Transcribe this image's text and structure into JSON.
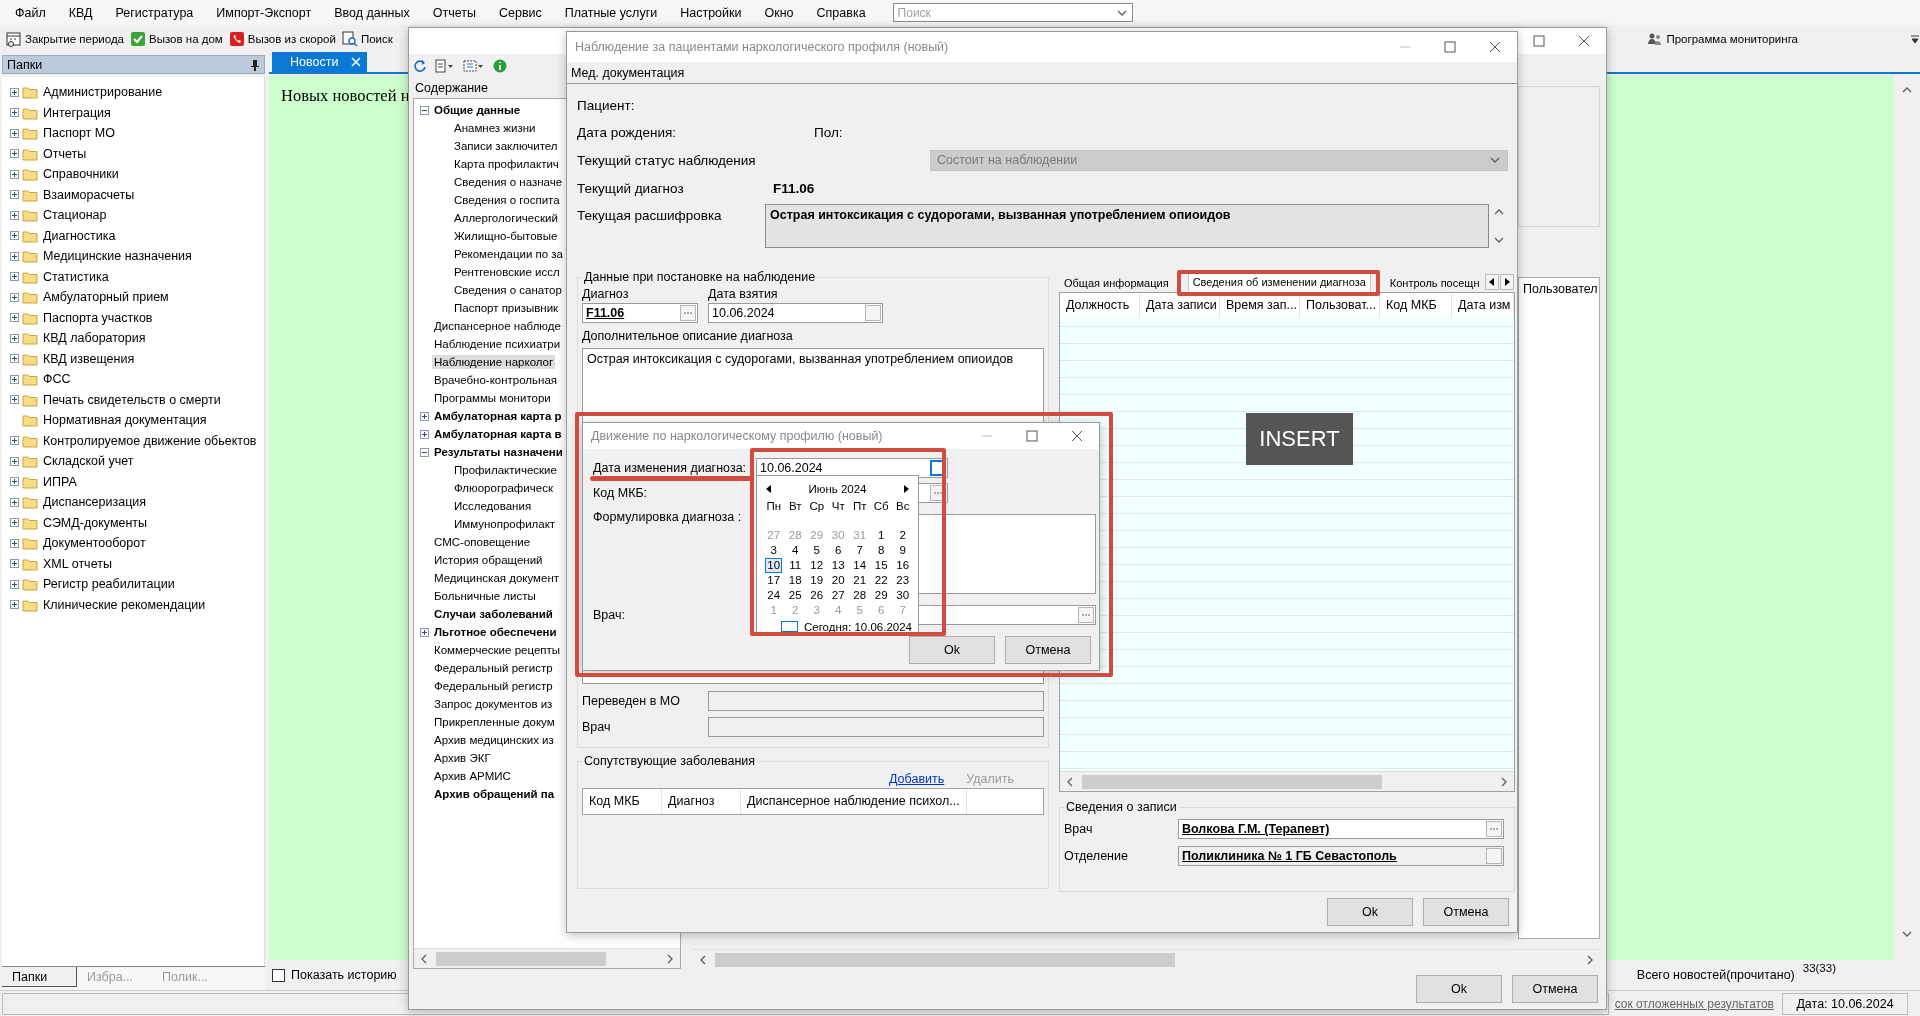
{
  "menu": [
    "Файл",
    "КВД",
    "Регистратура",
    "Импорт-Экспорт",
    "Ввод данных",
    "Отчеты",
    "Сервис",
    "Платные услуги",
    "Настройки",
    "Окно",
    "Справка"
  ],
  "search": {
    "placeholder": "Поиск"
  },
  "toolbar": [
    {
      "label": "Закрытие периода",
      "kind": "period"
    },
    {
      "label": "Вызов на дом",
      "kind": "home"
    },
    {
      "label": "Вызов из скорой",
      "kind": "ambulance"
    },
    {
      "label": "Поиск",
      "kind": "search"
    }
  ],
  "toolbar_right": {
    "label": "Программа мониторинга"
  },
  "folders": {
    "title": "Папки",
    "items": [
      {
        "label": "Администрирование",
        "kind": "group"
      },
      {
        "label": "Интеграция",
        "kind": "group"
      },
      {
        "label": "Паспорт МО",
        "kind": "group"
      },
      {
        "label": "Отчеты",
        "kind": "group"
      },
      {
        "label": "Справочники",
        "kind": "group"
      },
      {
        "label": "Взаиморасчеты",
        "kind": "group"
      },
      {
        "label": "Стационар",
        "kind": "group"
      },
      {
        "label": "Диагностика",
        "kind": "group"
      },
      {
        "label": "Медицинские назначения",
        "kind": "group"
      },
      {
        "label": "Статистика",
        "kind": "group"
      },
      {
        "label": "Амбулаторный прием",
        "kind": "group"
      },
      {
        "label": "Паспорта участков",
        "kind": "group"
      },
      {
        "label": "КВД лаборатория",
        "kind": "group"
      },
      {
        "label": "КВД извещения",
        "kind": "group"
      },
      {
        "label": "ФСС",
        "kind": "group"
      },
      {
        "label": "Печать свидетельств о смерти",
        "kind": "group"
      },
      {
        "label": "Нормативная документация",
        "kind": "leaf"
      },
      {
        "label": "Контролируемое движение обьектов",
        "kind": "group"
      },
      {
        "label": "Складской учет",
        "kind": "group"
      },
      {
        "label": "ИПРА",
        "kind": "group"
      },
      {
        "label": "Диспансеризация",
        "kind": "group"
      },
      {
        "label": "СЭМД-документы",
        "kind": "group"
      },
      {
        "label": "Документооборот",
        "kind": "group"
      },
      {
        "label": "XML отчеты",
        "kind": "group"
      },
      {
        "label": "Регистр реабилитации",
        "kind": "group"
      },
      {
        "label": "Клинические рекомендации",
        "kind": "group"
      }
    ],
    "tabs": [
      {
        "label": "Папки",
        "selected": true
      },
      {
        "label": "Избра...",
        "selected": false
      },
      {
        "label": "Полик...",
        "selected": false
      }
    ]
  },
  "news": {
    "tab": "Новости",
    "message": "Новых новостей н",
    "show_history": {
      "label": "Показать историю",
      "checked": false
    },
    "total_label": "Всего новостей(прочитано)",
    "total_count": "33(33)"
  },
  "status_bar": {
    "link": "сок отложенных результатов",
    "date": "Дата: 10.06.2024"
  },
  "contents_window": {
    "label": "Содержание",
    "column": "Пользовател",
    "buttons": [
      "Ok",
      "Отмена"
    ],
    "tree": [
      {
        "label": "Общие данные",
        "kind": "group",
        "expanded": true,
        "bold": true,
        "selected": false,
        "children": [
          {
            "label": "Анамнез жизни",
            "kind": "leaf",
            "bold": false,
            "selected": false
          },
          {
            "label": "Записи заключител",
            "kind": "leaf",
            "bold": false,
            "selected": false
          },
          {
            "label": "Карта профилактич",
            "kind": "leaf",
            "bold": false,
            "selected": false
          },
          {
            "label": "Сведения о назначе",
            "kind": "leaf",
            "bold": false,
            "selected": false
          },
          {
            "label": "Сведения о госпита",
            "kind": "leaf",
            "bold": false,
            "selected": false
          },
          {
            "label": "Аллергологический",
            "kind": "leaf",
            "bold": false,
            "selected": false
          },
          {
            "label": "Жилищно-бытовые",
            "kind": "leaf",
            "bold": false,
            "selected": false
          },
          {
            "label": "Рекомендации по за",
            "kind": "leaf",
            "bold": false,
            "selected": false
          },
          {
            "label": "Рентгеновские иссл",
            "kind": "leaf",
            "bold": false,
            "selected": false
          },
          {
            "label": "Сведения о санатор",
            "kind": "leaf",
            "bold": false,
            "selected": false
          },
          {
            "label": "Паспорт призывник",
            "kind": "leaf",
            "bold": false,
            "selected": false
          }
        ]
      },
      {
        "label": "Диспансерное наблюде",
        "kind": "leaf",
        "bold": false,
        "selected": false
      },
      {
        "label": "Наблюдение психиатри",
        "kind": "leaf",
        "bold": false,
        "selected": false
      },
      {
        "label": "Наблюдение нарколог",
        "kind": "leaf",
        "bold": false,
        "selected": true
      },
      {
        "label": "Врачебно-контрольная",
        "kind": "leaf",
        "bold": false,
        "selected": false
      },
      {
        "label": "Программы монитори",
        "kind": "leaf",
        "bold": false,
        "selected": false
      },
      {
        "label": "Амбулаторная карта р",
        "kind": "group",
        "expanded": false,
        "bold": true,
        "selected": false
      },
      {
        "label": "Амбулаторная карта в",
        "kind": "group",
        "expanded": false,
        "bold": true,
        "selected": false
      },
      {
        "label": "Результаты назначени",
        "kind": "group",
        "expanded": true,
        "bold": true,
        "selected": false,
        "children": [
          {
            "label": "Профилактические",
            "kind": "leaf",
            "bold": false,
            "selected": false
          },
          {
            "label": "Флюорографическ",
            "kind": "leaf",
            "bold": false,
            "selected": false
          },
          {
            "label": "Исследования",
            "kind": "leaf",
            "bold": false,
            "selected": false
          },
          {
            "label": "Иммунопрофилакт",
            "kind": "leaf",
            "bold": false,
            "selected": false
          }
        ]
      },
      {
        "label": "СМС-оповещение",
        "kind": "leaf",
        "bold": false,
        "selected": false
      },
      {
        "label": "История обращений",
        "kind": "leaf",
        "bold": false,
        "selected": false
      },
      {
        "label": "Медицинская документ",
        "kind": "leaf",
        "bold": false,
        "selected": false
      },
      {
        "label": "Больничные листы",
        "kind": "leaf",
        "bold": false,
        "selected": false
      },
      {
        "label": "Случаи заболеваний",
        "kind": "leaf",
        "bold": true,
        "selected": false
      },
      {
        "label": "Льготное обеспечени",
        "kind": "group",
        "expanded": false,
        "bold": true,
        "selected": false
      },
      {
        "label": "Коммерческие рецепты",
        "kind": "leaf",
        "bold": false,
        "selected": false
      },
      {
        "label": "Федеральный регистр",
        "kind": "leaf",
        "bold": false,
        "selected": false
      },
      {
        "label": "Федеральный регистр",
        "kind": "leaf",
        "bold": false,
        "selected": false
      },
      {
        "label": "Запрос документов из",
        "kind": "leaf",
        "bold": false,
        "selected": false
      },
      {
        "label": "Прикрепленные докум",
        "kind": "leaf",
        "bold": false,
        "selected": false
      },
      {
        "label": "Архив медицинских из",
        "kind": "leaf",
        "bold": false,
        "selected": false
      },
      {
        "label": "Архив ЭКГ",
        "kind": "leaf",
        "bold": false,
        "selected": false
      },
      {
        "label": "Архив АРМИС",
        "kind": "leaf",
        "bold": false,
        "selected": false
      },
      {
        "label": "Архив обращений па",
        "kind": "leaf",
        "bold": true,
        "selected": false
      }
    ]
  },
  "observation_dialog": {
    "title": "Наблюдение за пациентами наркологического профиля (новый)",
    "menu": "Мед. документация",
    "patient_label": "Пациент:",
    "birth_label": "Дата рождения:",
    "sex_label": "Пол:",
    "status_label": "Текущий статус наблюдения",
    "status_value": "Состоит на наблюдении",
    "diagnosis_label": "Текущий диагноз",
    "diagnosis_value": "F11.06",
    "decoding_label": "Текущая расшифровка",
    "decoding_value": "Острая интоксикация с судорогами, вызванная употреблением опиоидов",
    "registration": {
      "title": "Данные при постановке на наблюдение",
      "diagnosis_label": "Диагноз",
      "diagnosis_value": "F11.06",
      "date_label": "Дата взятия",
      "date_value": "10.06.2024",
      "extra_label": "Дополнительное описание диагноза",
      "extra_value": "Острая интоксикация с судорогами, вызванная употреблением опиоидов",
      "transferred_label": "Переведен в МО",
      "doctor_label": "Врач"
    },
    "comorbid": {
      "title": "Сопутствующие заболевания",
      "add": "Добавить",
      "delete": "Удалить",
      "columns": [
        "Код МКБ",
        "Диагноз",
        "Диспансерное наблюдение психол..."
      ]
    },
    "tabs": [
      {
        "label": "Общая информация",
        "selected": false
      },
      {
        "label": "Сведения об изменении диагноза",
        "selected": true
      },
      {
        "label": "Контроль посещн",
        "selected": false
      }
    ],
    "grid_columns": [
      "Должность",
      "Дата записи",
      "Время зап...",
      "Пользоват...",
      "Код МКБ",
      "Дата изм"
    ],
    "overlay_label": "INSERT",
    "record": {
      "title": "Сведения о записи",
      "doctor_label": "Врач",
      "doctor_value": "Волкова Г.М. (Терапевт)",
      "department_label": "Отделение",
      "department_value": "Поликлиника № 1 ГБ Севастополь"
    },
    "buttons": [
      "Ok",
      "Отмена"
    ]
  },
  "movement_dialog": {
    "title": "Движение по наркологическому профилю (новый)",
    "date_label": "Дата изменения диагноза:",
    "date_value": "10.06.2024",
    "icd_label": "Код МКБ:",
    "wording_label": "Формулировка диагноза :",
    "doctor_label": "Врач:",
    "buttons": [
      "Ok",
      "Отмена"
    ],
    "calendar": {
      "month": "Июнь 2024",
      "weekdays": [
        "Пн",
        "Вт",
        "Ср",
        "Чт",
        "Пт",
        "Сб",
        "Вс"
      ],
      "today": "Сегодня: 10.06.2024",
      "days": [
        {
          "label": "27",
          "other_month": true,
          "selected": false
        },
        {
          "label": "28",
          "other_month": true,
          "selected": false
        },
        {
          "label": "29",
          "other_month": true,
          "selected": false
        },
        {
          "label": "30",
          "other_month": true,
          "selected": false
        },
        {
          "label": "31",
          "other_month": true,
          "selected": false
        },
        {
          "label": "1",
          "other_month": false,
          "selected": false
        },
        {
          "label": "2",
          "other_month": false,
          "selected": false
        },
        {
          "label": "3",
          "other_month": false,
          "selected": false
        },
        {
          "label": "4",
          "other_month": false,
          "selected": false
        },
        {
          "label": "5",
          "other_month": false,
          "selected": false
        },
        {
          "label": "6",
          "other_month": false,
          "selected": false
        },
        {
          "label": "7",
          "other_month": false,
          "selected": false
        },
        {
          "label": "8",
          "other_month": false,
          "selected": false
        },
        {
          "label": "9",
          "other_month": false,
          "selected": false
        },
        {
          "label": "10",
          "other_month": false,
          "selected": true
        },
        {
          "label": "11",
          "other_month": false,
          "selected": false
        },
        {
          "label": "12",
          "other_month": false,
          "selected": false
        },
        {
          "label": "13",
          "other_month": false,
          "selected": false
        },
        {
          "label": "14",
          "other_month": false,
          "selected": false
        },
        {
          "label": "15",
          "other_month": false,
          "selected": false
        },
        {
          "label": "16",
          "other_month": false,
          "selected": false
        },
        {
          "label": "17",
          "other_month": false,
          "selected": false
        },
        {
          "label": "18",
          "other_month": false,
          "selected": false
        },
        {
          "label": "19",
          "other_month": false,
          "selected": false
        },
        {
          "label": "20",
          "other_month": false,
          "selected": false
        },
        {
          "label": "21",
          "other_month": false,
          "selected": false
        },
        {
          "label": "22",
          "other_month": false,
          "selected": false
        },
        {
          "label": "23",
          "other_month": false,
          "selected": false
        },
        {
          "label": "24",
          "other_month": false,
          "selected": false
        },
        {
          "label": "25",
          "other_month": false,
          "selected": false
        },
        {
          "label": "26",
          "other_month": false,
          "selected": false
        },
        {
          "label": "27",
          "other_month": false,
          "selected": false
        },
        {
          "label": "28",
          "other_month": false,
          "selected": false
        },
        {
          "label": "29",
          "other_month": false,
          "selected": false
        },
        {
          "label": "30",
          "other_month": false,
          "selected": false
        },
        {
          "label": "1",
          "other_month": true,
          "selected": false
        },
        {
          "label": "2",
          "other_month": true,
          "selected": false
        },
        {
          "label": "3",
          "other_month": true,
          "selected": false
        },
        {
          "label": "4",
          "other_month": true,
          "selected": false
        },
        {
          "label": "5",
          "other_month": true,
          "selected": false
        },
        {
          "label": "6",
          "other_month": true,
          "selected": false
        },
        {
          "label": "7",
          "other_month": true,
          "selected": false
        }
      ]
    }
  }
}
